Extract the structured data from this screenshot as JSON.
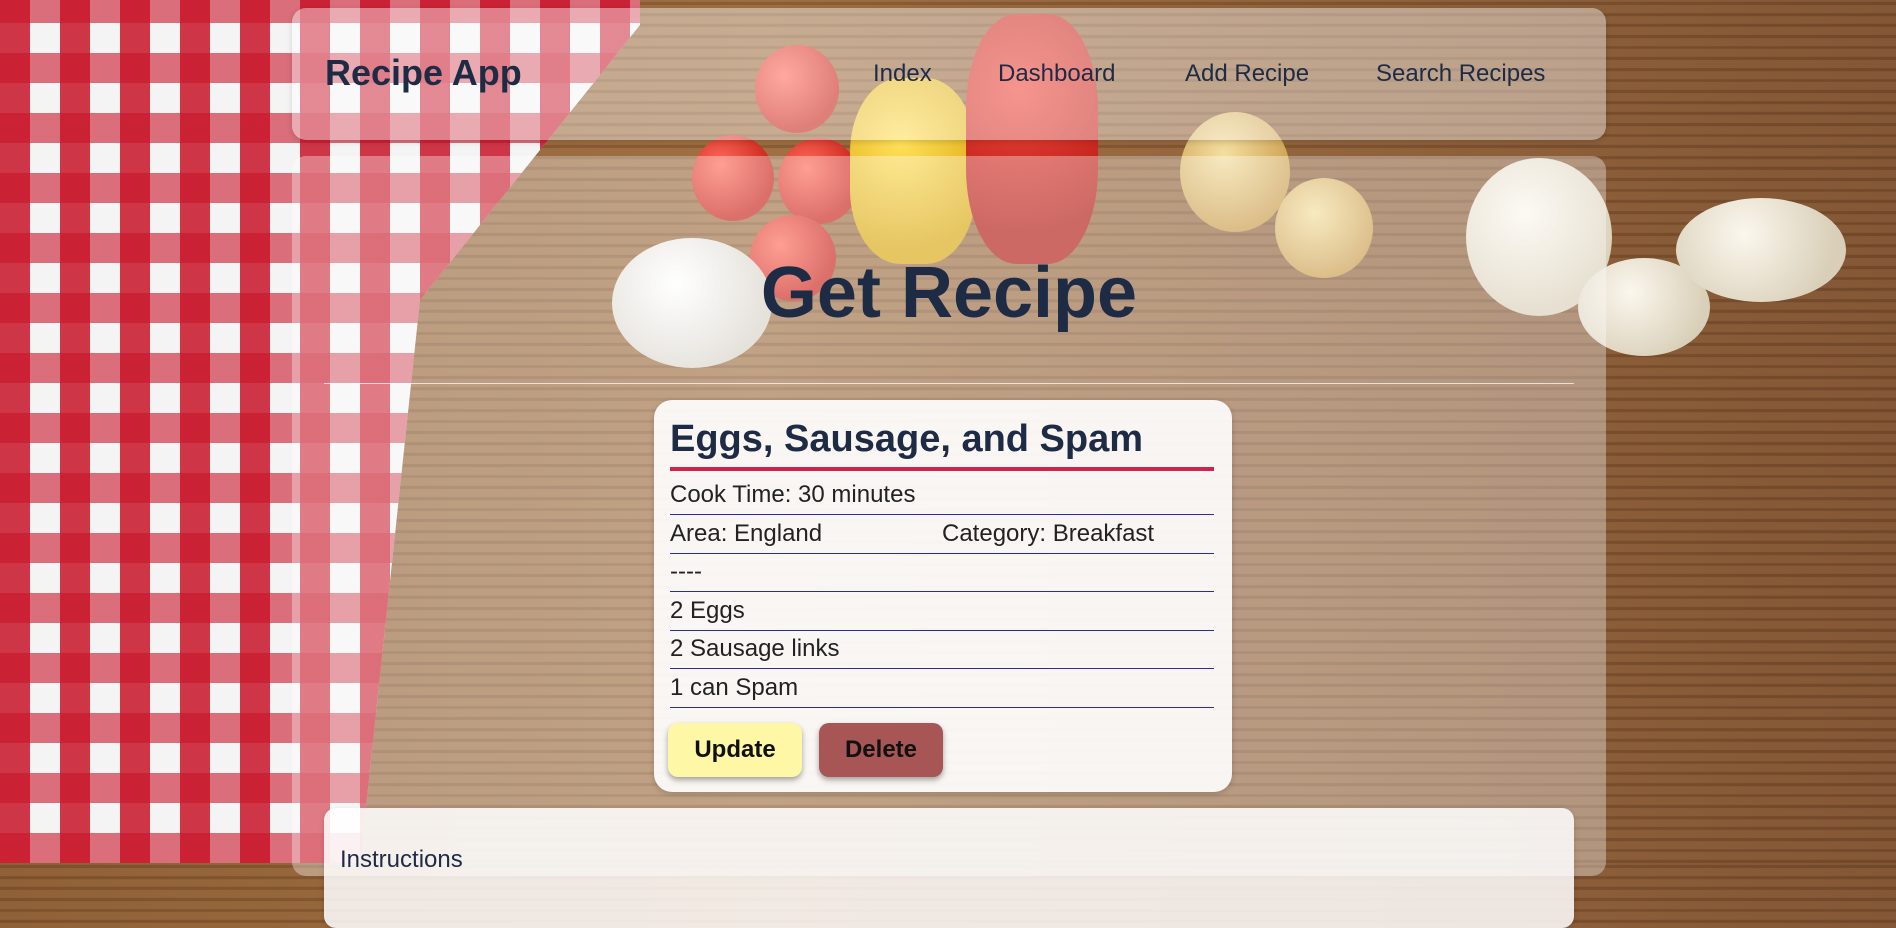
{
  "navbar": {
    "brand": "Recipe App",
    "links": [
      "Index",
      "Dashboard",
      "Add Recipe",
      "Search Recipes"
    ]
  },
  "page": {
    "title": "Get Recipe"
  },
  "recipe": {
    "name": "Eggs, Sausage, and Spam",
    "cook_time": "Cook Time: 30 minutes",
    "area": "Area: England",
    "category": "Category: Breakfast",
    "separator": "----",
    "ingredients": [
      "2 Eggs",
      "2 Sausage links",
      "1 can Spam"
    ],
    "update_label": "Update",
    "delete_label": "Delete"
  },
  "instructions": {
    "label": "Instructions"
  },
  "colors": {
    "update_button": "#fdf7a6",
    "delete_button": "#a75555",
    "title_underline": "#c8264f",
    "text_dark": "#1e2b44"
  }
}
